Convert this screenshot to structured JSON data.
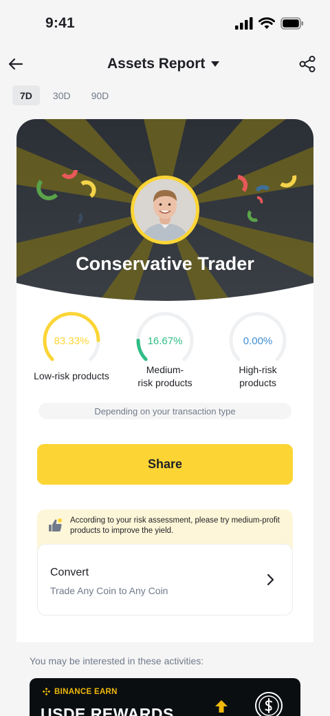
{
  "status": {
    "time": "9:41"
  },
  "nav": {
    "title": "Assets Report"
  },
  "periods": [
    {
      "label": "7D",
      "active": true
    },
    {
      "label": "30D",
      "active": false
    },
    {
      "label": "90D",
      "active": false
    }
  ],
  "hero": {
    "title": "Conservative Trader"
  },
  "gauges": [
    {
      "value": "83.33%",
      "fraction": 0.8333,
      "label_line1": "Low-risk products",
      "label_line2": "",
      "color": "#fcd535"
    },
    {
      "value": "16.67%",
      "fraction": 0.1667,
      "label_line1": "Medium-",
      "label_line2": "risk products",
      "color": "#2ebd85"
    },
    {
      "value": "0.00%",
      "fraction": 0.0,
      "label_line1": "High-risk",
      "label_line2": "products",
      "color": "#3e8fd6"
    }
  ],
  "hint": "Depending on your transaction type",
  "share_label": "Share",
  "advice": {
    "text": "According to your risk assessment, please try medium-profit products to improve the yield.",
    "convert_title": "Convert",
    "convert_subtitle": "Trade Any Coin to Any Coin"
  },
  "interest_label": "You may be interested in these activities:",
  "banner": {
    "brand": "BINANCE EARN",
    "headline": "USDE REWARDS"
  },
  "colors": {
    "accent": "#fcd535",
    "green": "#2ebd85",
    "blue": "#3e8fd6",
    "text": "#1e2026",
    "muted": "#707a8a"
  }
}
